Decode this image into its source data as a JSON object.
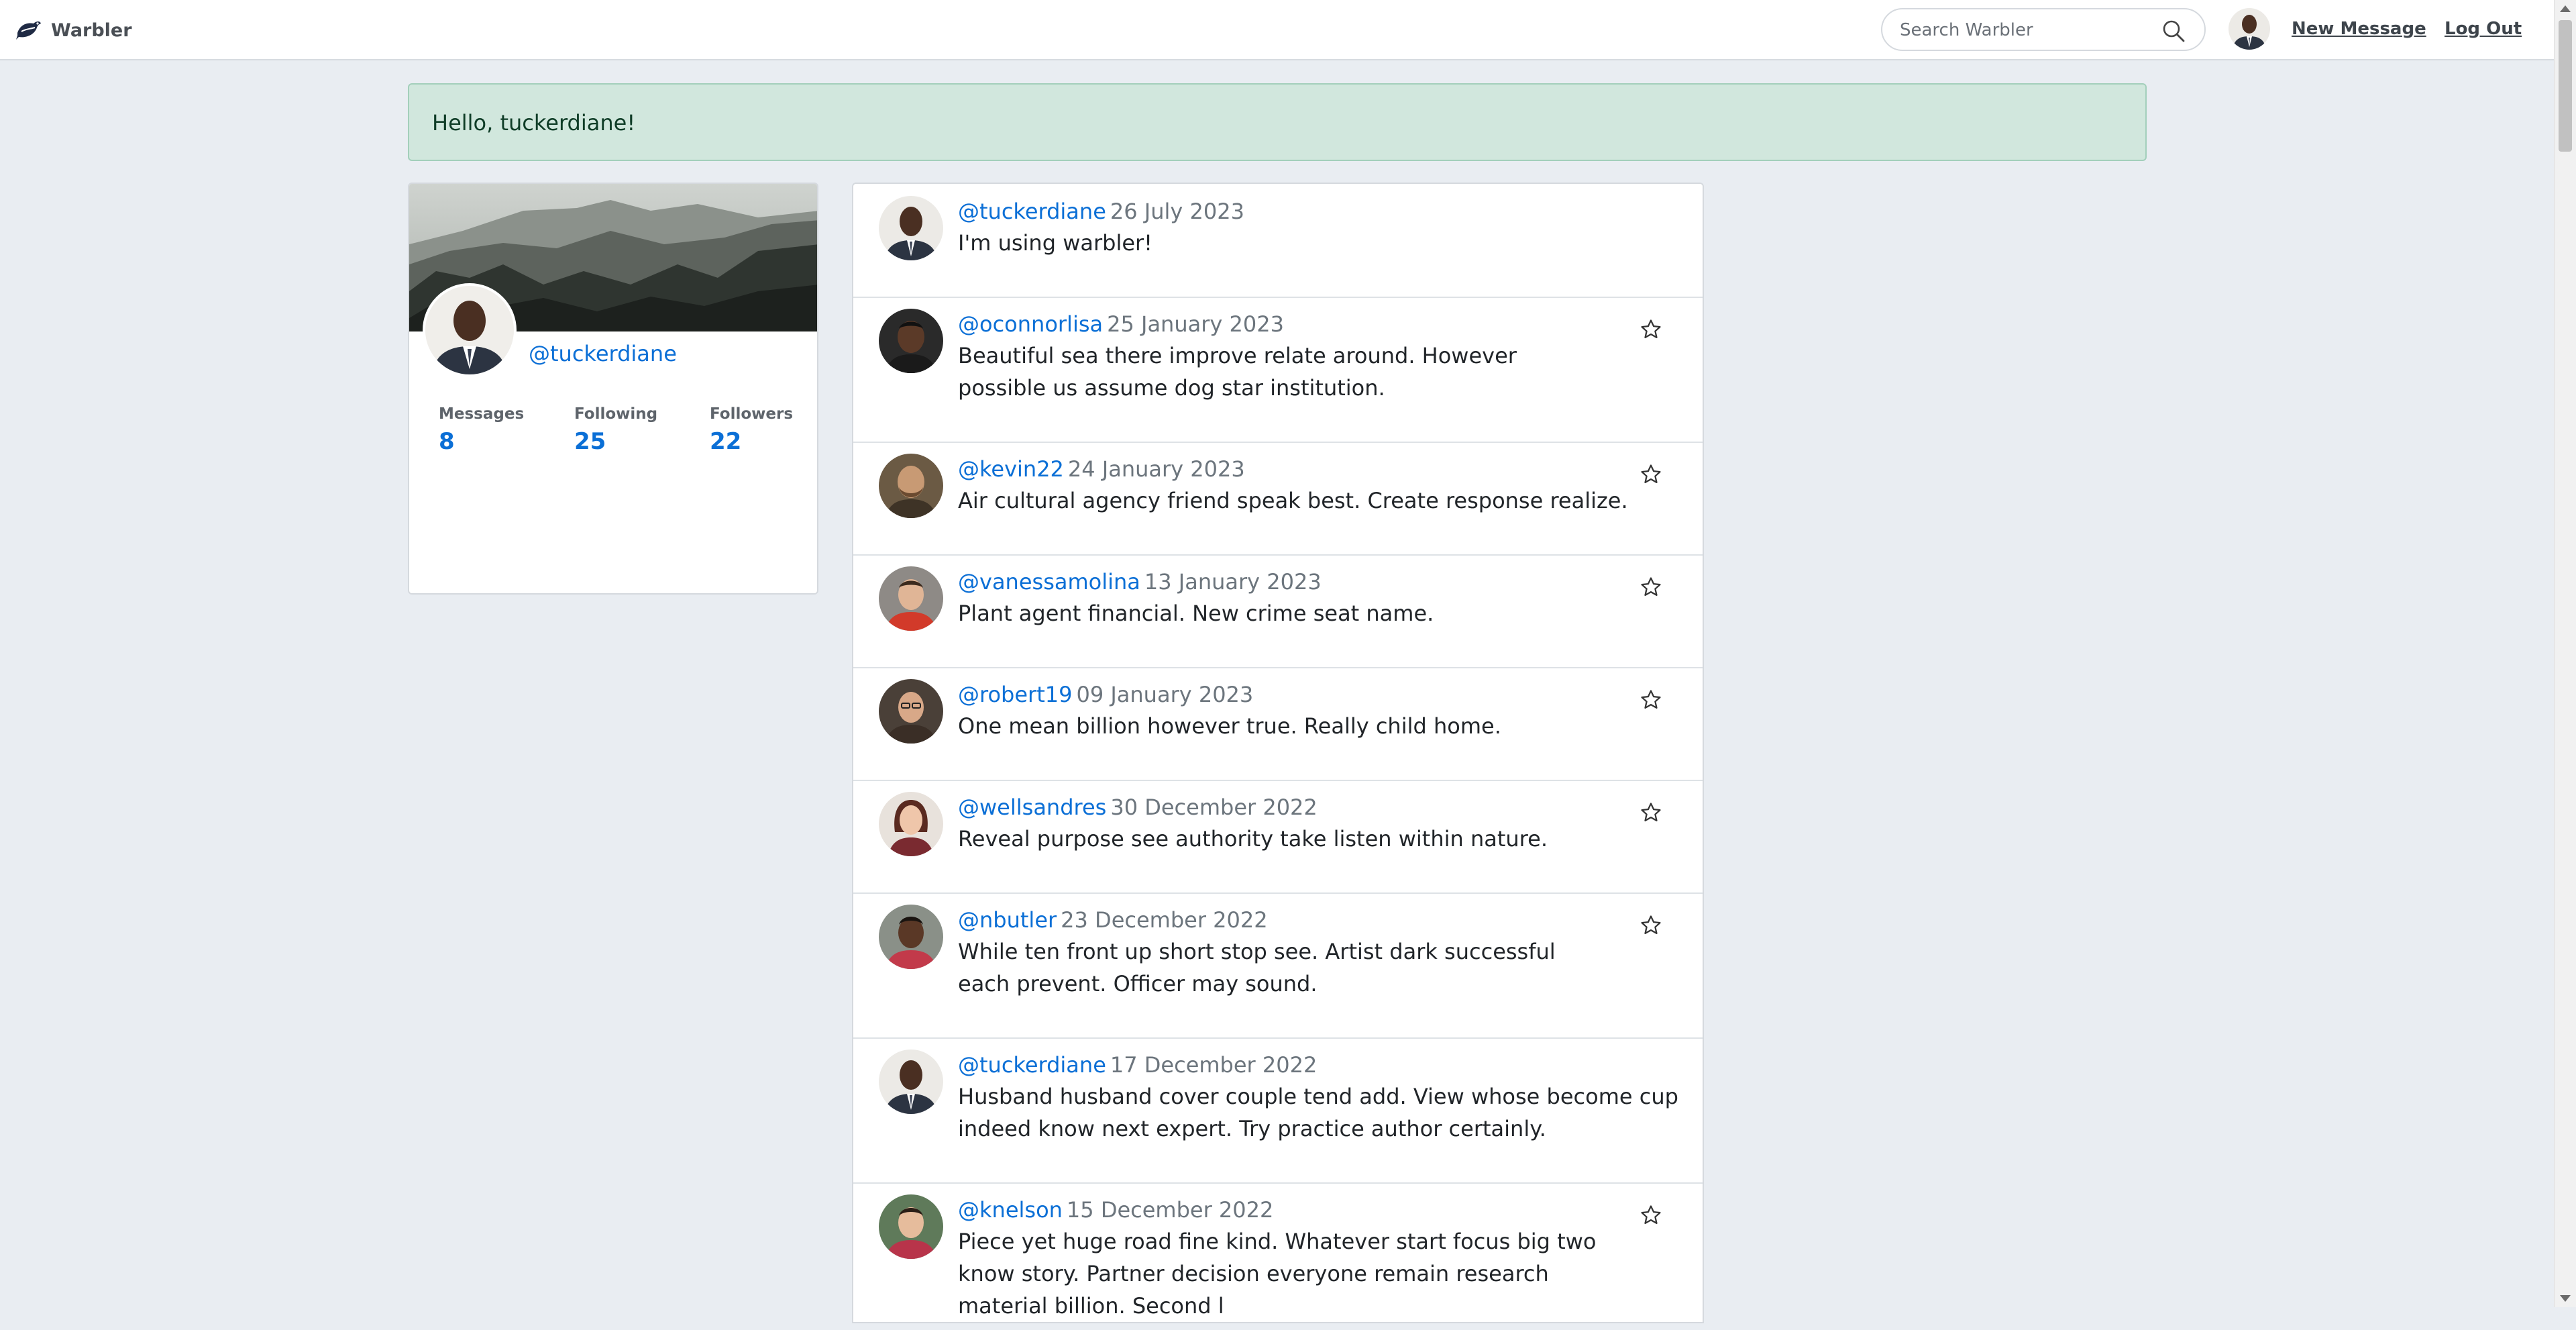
{
  "navbar": {
    "brand": "Warbler",
    "search_placeholder": "Search Warbler",
    "new_message": "New Message",
    "log_out": "Log Out"
  },
  "alert": {
    "text": "Hello, tuckerdiane!"
  },
  "profile": {
    "username": "@tuckerdiane",
    "stats": [
      {
        "label": "Messages",
        "value": "8"
      },
      {
        "label": "Following",
        "value": "25"
      },
      {
        "label": "Followers",
        "value": "22"
      }
    ]
  },
  "messages": [
    {
      "user": "@tuckerdiane",
      "date": "26 July 2023",
      "text": "I'm using warbler!",
      "star": false
    },
    {
      "user": "@oconnorlisa",
      "date": "25 January 2023",
      "text": "Beautiful sea there improve relate around. However possible us assume dog star institution.",
      "star": true
    },
    {
      "user": "@kevin22",
      "date": "24 January 2023",
      "text": "Air cultural agency friend speak best. Create response realize.",
      "star": true
    },
    {
      "user": "@vanessamolina",
      "date": "13 January 2023",
      "text": "Plant agent financial. New crime seat name.",
      "star": true
    },
    {
      "user": "@robert19",
      "date": "09 January 2023",
      "text": "One mean billion however true. Really child home.",
      "star": true
    },
    {
      "user": "@wellsandres",
      "date": "30 December 2022",
      "text": "Reveal purpose see authority take listen within nature.",
      "star": true
    },
    {
      "user": "@nbutler",
      "date": "23 December 2022",
      "text": "While ten front up short stop see. Artist dark successful each prevent. Officer may sound.",
      "star": true
    },
    {
      "user": "@tuckerdiane",
      "date": "17 December 2022",
      "text": "Husband husband cover couple tend add. View whose become cup indeed know next expert. Try practice author certainly.",
      "star": false
    },
    {
      "user": "@knelson",
      "date": "15 December 2022",
      "text": "Piece yet huge road fine kind. Whatever start focus big two know story. Partner decision everyone remain research material billion. Second l",
      "star": true
    }
  ],
  "colors": {
    "background": "#e9edf2",
    "link": "#0b6fd6",
    "alert_bg": "#d1e7dd",
    "alert_border": "#a3cfbb"
  }
}
